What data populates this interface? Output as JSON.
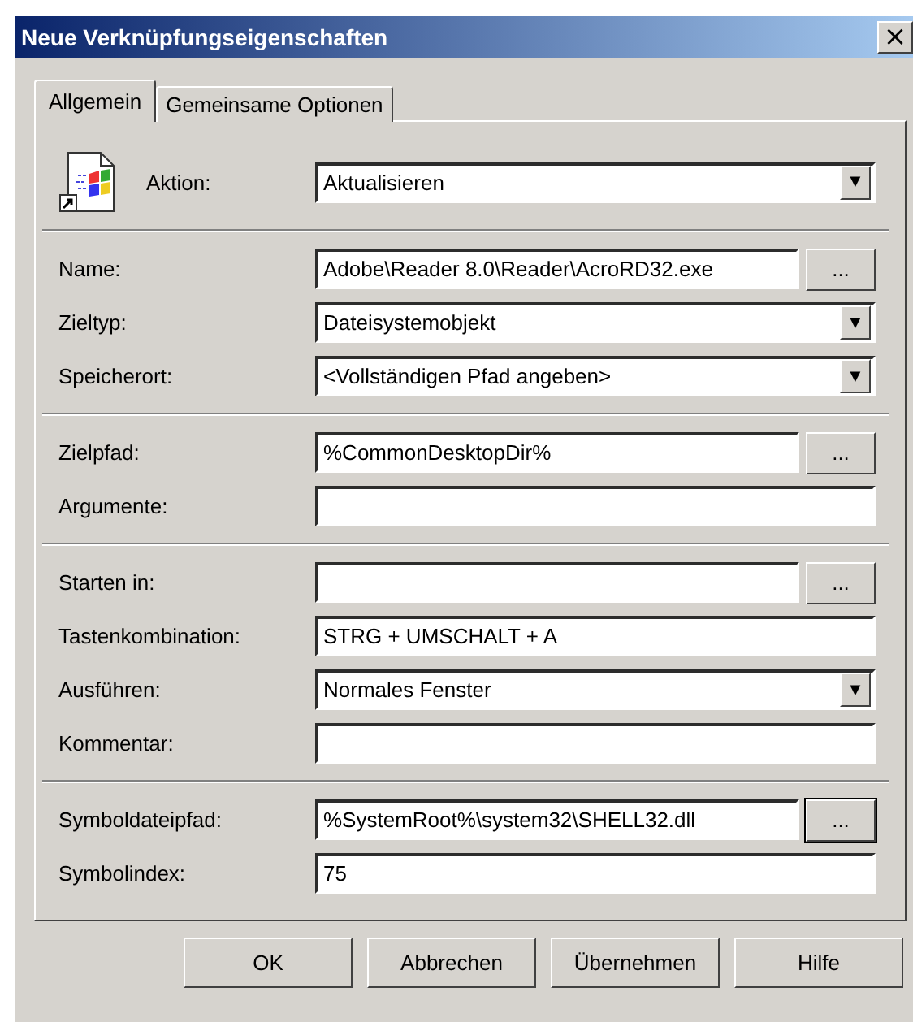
{
  "window": {
    "title": "Neue Verknüpfungseigenschaften",
    "close": "×"
  },
  "tabs": [
    {
      "label": "Allgemein",
      "selected": true
    },
    {
      "label": "Gemeinsame Optionen",
      "selected": false
    }
  ],
  "action": {
    "label": "Aktion:",
    "value": "Aktualisieren",
    "arrow": "▼"
  },
  "sections": [
    [
      {
        "kind": "browse",
        "label": "Name:",
        "value": "Adobe\\Reader 8.0\\Reader\\AcroRD32.exe",
        "button": "...",
        "focused": false
      },
      {
        "kind": "combo",
        "label": "Zieltyp:",
        "value": "Dateisystemobjekt",
        "arrow": "▼"
      },
      {
        "kind": "combo",
        "label": "Speicherort:",
        "value": "<Vollständigen Pfad angeben>",
        "arrow": "▼"
      }
    ],
    [
      {
        "kind": "browse",
        "label": "Zielpfad:",
        "value": "%CommonDesktopDir%",
        "button": "...",
        "focused": false
      },
      {
        "kind": "text",
        "label": "Argumente:"
      }
    ],
    [
      {
        "kind": "browse",
        "label": "Starten in:",
        "button": "...",
        "focused": false
      },
      {
        "kind": "text",
        "label": "Tastenkombination:",
        "value": "STRG + UMSCHALT + A"
      },
      {
        "kind": "combo",
        "label": "Ausführen:",
        "value": "Normales Fenster",
        "arrow": "▼"
      },
      {
        "kind": "text",
        "label": "Kommentar:"
      }
    ],
    [
      {
        "kind": "browse",
        "label": "Symboldateipfad:",
        "value": "%SystemRoot%\\system32\\SHELL32.dll",
        "button": "...",
        "focused": true
      },
      {
        "kind": "text",
        "label": "Symbolindex:",
        "value": "75"
      }
    ]
  ],
  "buttons": [
    "OK",
    "Abbrechen",
    "Übernehmen",
    "Hilfe"
  ]
}
